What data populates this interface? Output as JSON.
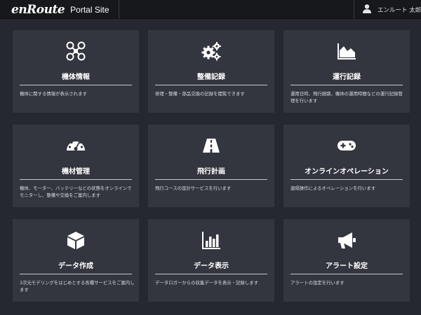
{
  "header": {
    "logo": "enRoute",
    "site_title": "Portal Site",
    "user_name": "エンルート 太郎",
    "user_icon": "user-icon"
  },
  "cards": [
    {
      "title": "機体情報",
      "description": "機体に関する情報が表示されます",
      "icon": "drone-icon"
    },
    {
      "title": "整備記録",
      "description": "修理・整備・部品交換の記録を閲覧できます",
      "icon": "gears-icon"
    },
    {
      "title": "運行記録",
      "description": "運用日時、飛行経路、機体の運用時間などの運行記録管理を行います",
      "icon": "area-chart-icon"
    },
    {
      "title": "機材管理",
      "description": "機体、モーター、バッテリーなどの状態をオンラインでモニターし、整備や交換をご案内します",
      "icon": "gauge-icon"
    },
    {
      "title": "飛行計画",
      "description": "飛行コースの設計サービスを行います",
      "icon": "road-icon"
    },
    {
      "title": "オンラインオペレーション",
      "description": "遠隔操作によるオペレーションを行います",
      "icon": "gamepad-icon"
    },
    {
      "title": "データ作成",
      "description": "3次元モデリングをはじめとする各種サービスをご案内します",
      "icon": "cube-icon"
    },
    {
      "title": "データ表示",
      "description": "データロガーからの収集データを表示・記録します",
      "icon": "bar-chart-icon"
    },
    {
      "title": "アラート設定",
      "description": "アラートの設定を行います",
      "icon": "bullhorn-icon"
    }
  ]
}
